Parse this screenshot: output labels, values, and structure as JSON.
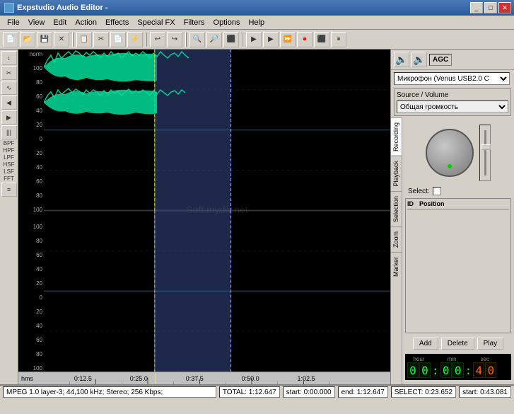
{
  "window": {
    "title": "Expstudio Audio Editor -",
    "controls": [
      "_",
      "□",
      "✕"
    ]
  },
  "menu": {
    "items": [
      "File",
      "View",
      "Edit",
      "Action",
      "Effects",
      "Special FX",
      "Filters",
      "Options",
      "Help"
    ]
  },
  "toolbar": {
    "buttons": [
      "📂",
      "💾",
      "✕",
      "📋",
      "✂",
      "📄",
      "↩",
      "↪",
      "🔍+",
      "🔍-",
      "⬛",
      "▶",
      "⏸",
      "⏩",
      "⏺",
      "⬛",
      "⬜"
    ]
  },
  "left_tools": {
    "items": [
      "↕",
      "✂",
      "∿",
      "◀",
      "▶",
      "|||",
      "BPF",
      "HPF",
      "LPF",
      "HSF",
      "LSF",
      "FFT",
      "≡"
    ]
  },
  "waveform": {
    "timeline_labels": [
      "hms",
      "0:12.5",
      "0:25.0",
      "0:37.5",
      "0:50.0",
      "1:02.5"
    ],
    "norm_labels_top": [
      "norm",
      "100",
      "80",
      "60",
      "40",
      "20",
      "0",
      "20",
      "40",
      "60",
      "80",
      "100"
    ],
    "norm_labels_bottom": [
      "100",
      "80",
      "60",
      "40",
      "20",
      "0",
      "20",
      "40",
      "60",
      "80",
      "100"
    ],
    "selection_start_pct": 32,
    "selection_width_pct": 22
  },
  "right_panel": {
    "device": "Микрофон (Venus USB2.0 C",
    "source_label": "Source / Volume",
    "source_value": "Общая громкость",
    "tabs": [
      "Recording",
      "Playback",
      "Selection",
      "Zoom",
      "Marker"
    ],
    "active_tab": "Recording",
    "select_label": "Select:",
    "agc_label": "AGC"
  },
  "marker": {
    "headers": [
      "ID",
      "Position"
    ],
    "buttons": [
      "Add",
      "Delete",
      "Play"
    ]
  },
  "clock": {
    "sections": [
      {
        "label": "hour",
        "digits": [
          "0",
          "0"
        ]
      },
      {
        "label": "min",
        "digits": [
          "0",
          "0"
        ]
      },
      {
        "label": "sec",
        "digits": [
          "4",
          "0"
        ]
      }
    ],
    "last_digits_active": true
  },
  "status": {
    "format": "MPEG 1.0 layer-3; 44,100 kHz; Stereo; 256 Kbps;",
    "total": "TOTAL: 1:12.647",
    "start": "start: 0:00.000",
    "end": "end: 1:12.647",
    "select": "SELECT: 0:23.652",
    "startval": "start: 0:43.081"
  }
}
